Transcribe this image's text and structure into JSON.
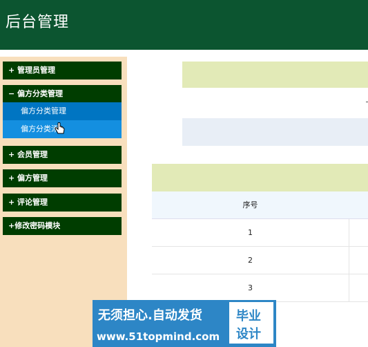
{
  "header": {
    "title": "后台管理"
  },
  "sidebar": {
    "items": [
      {
        "label": "+ 管理员管理"
      },
      {
        "label": "− 偏方分类管理"
      },
      {
        "label": "+ 会员管理"
      },
      {
        "label": "+ 偏方管理"
      },
      {
        "label": "+ 评论管理"
      },
      {
        "label": "+修改密码模块"
      }
    ],
    "subitems": [
      {
        "label": "偏方分类管理"
      },
      {
        "label": "偏方分类添"
      }
    ]
  },
  "table": {
    "header": "序号",
    "rows": [
      "1",
      "2",
      "3"
    ]
  },
  "banner": {
    "line1": "无须担心.自动发货",
    "line2": "www.51topmind.com",
    "box1": "毕业",
    "box2": "设计"
  },
  "colors": {
    "header_bg": "#0c5530",
    "sidebar_bg": "#f8dfbd",
    "menu_bg": "#003d00",
    "submenu_active": "#0075c2",
    "submenu_hover": "#148fe0",
    "band": "#e2eab7"
  }
}
